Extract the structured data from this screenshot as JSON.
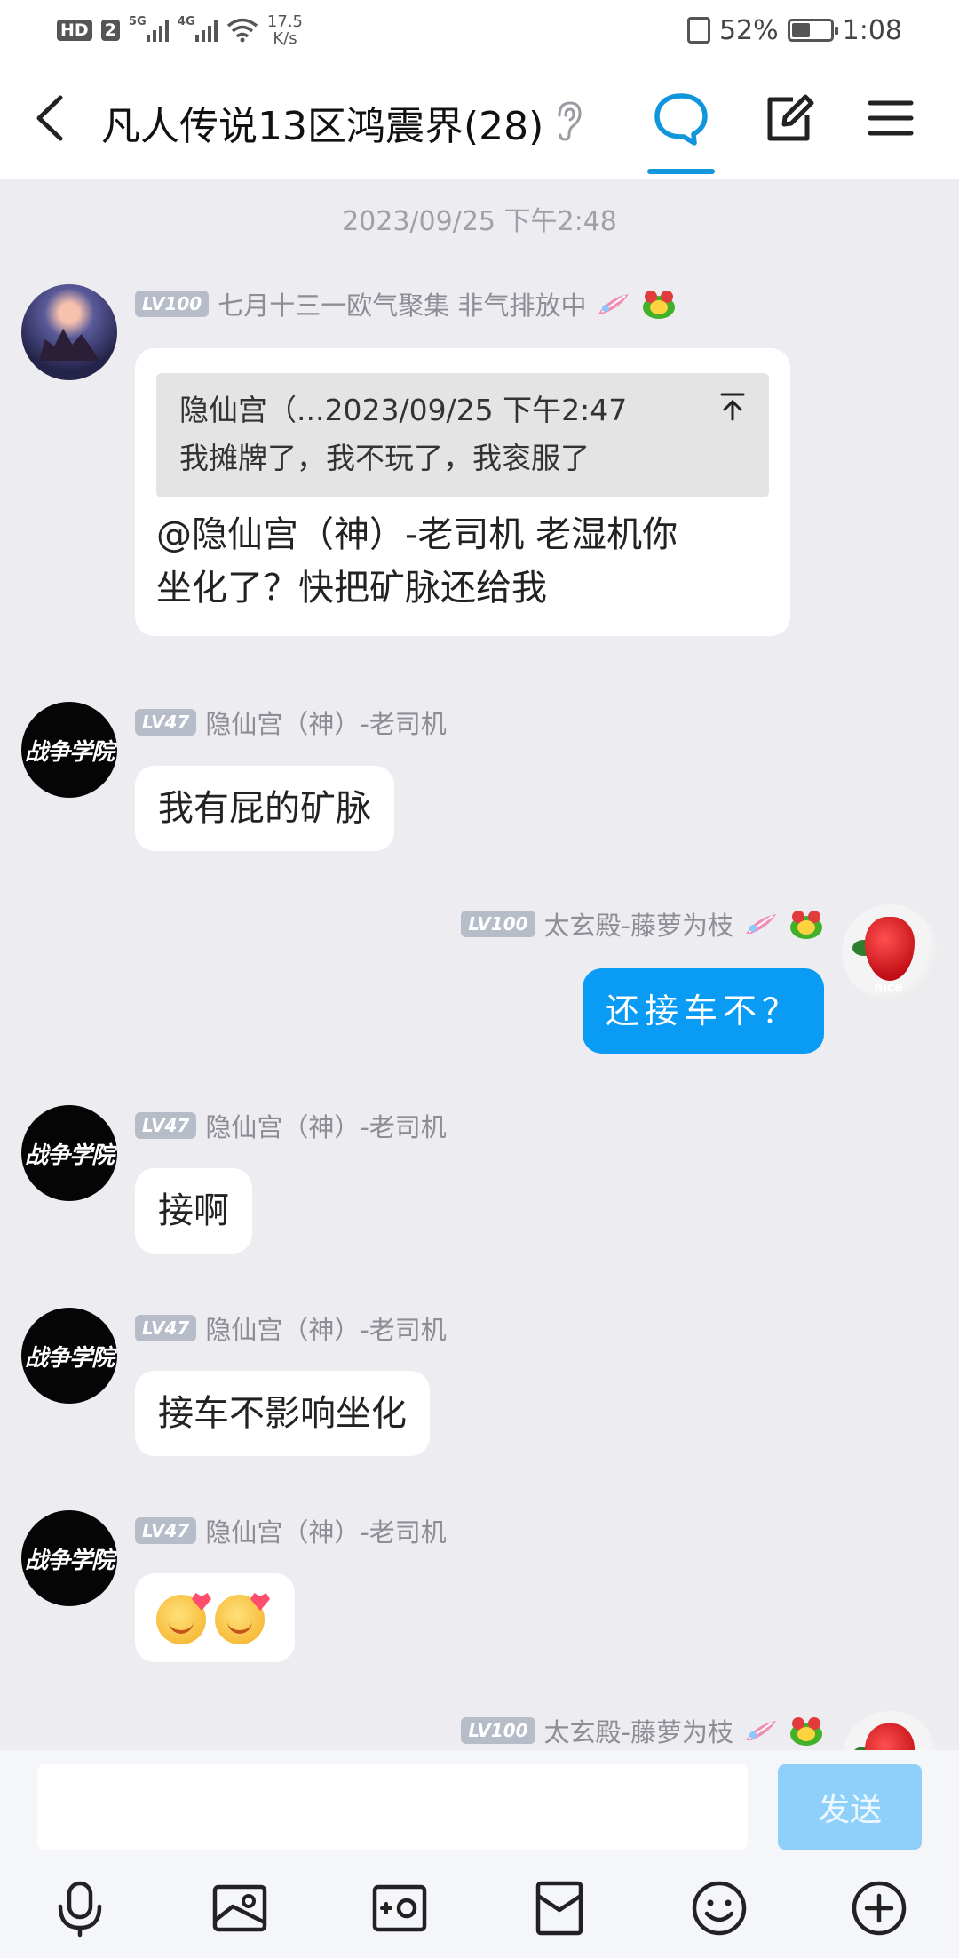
{
  "status_bar": {
    "hd": "HD",
    "sim": "2",
    "net1": "5G",
    "net2": "4G",
    "speed_value": "17.5",
    "speed_unit": "K/s",
    "battery_percent": "52%",
    "battery_level": 0.52,
    "time": "1:08"
  },
  "header": {
    "title": "凡人传说13区鸿震界(28)"
  },
  "timestamp": "2023/09/25 下午2:48",
  "messages": [
    {
      "level": "LV100",
      "sender": "七月十三一欧气聚集 非气排放中",
      "quote_title": "隐仙宫（...2023/09/25 下午2:47",
      "quote_text": "我摊牌了，我不玩了，我衮服了",
      "text_line1": "@隐仙宫（神）-老司机 老湿机你",
      "text_line2": "坐化了？快把矿脉还给我"
    },
    {
      "level": "LV47",
      "sender": "隐仙宫（神）-老司机",
      "text": "我有屁的矿脉"
    },
    {
      "level": "LV100",
      "sender": "太玄殿-藤萝为枝",
      "text": "还接车不？"
    },
    {
      "level": "LV47",
      "sender": "隐仙宫（神）-老司机",
      "text": "接啊"
    },
    {
      "level": "LV47",
      "sender": "隐仙宫（神）-老司机",
      "text": "接车不影响坐化"
    },
    {
      "level": "LV47",
      "sender": "隐仙宫（神）-老司机",
      "emojis": [
        "smile-heart",
        "smile-heart"
      ]
    },
    {
      "level": "LV100",
      "sender": "太玄殿-藤萝为枝"
    }
  ],
  "avatars": {
    "black_text": "战争学院",
    "strawberry_text": "nice"
  },
  "input": {
    "send_label": "发送"
  },
  "toolbar": [
    "mic-icon",
    "image-icon",
    "camera-icon",
    "red-packet-icon",
    "emoji-icon",
    "plus-icon"
  ],
  "colors": {
    "accent": "#1296db",
    "own_bubble": "#0a9bf5",
    "send_disabled": "#8fd0fb",
    "background": "#ececf1"
  }
}
